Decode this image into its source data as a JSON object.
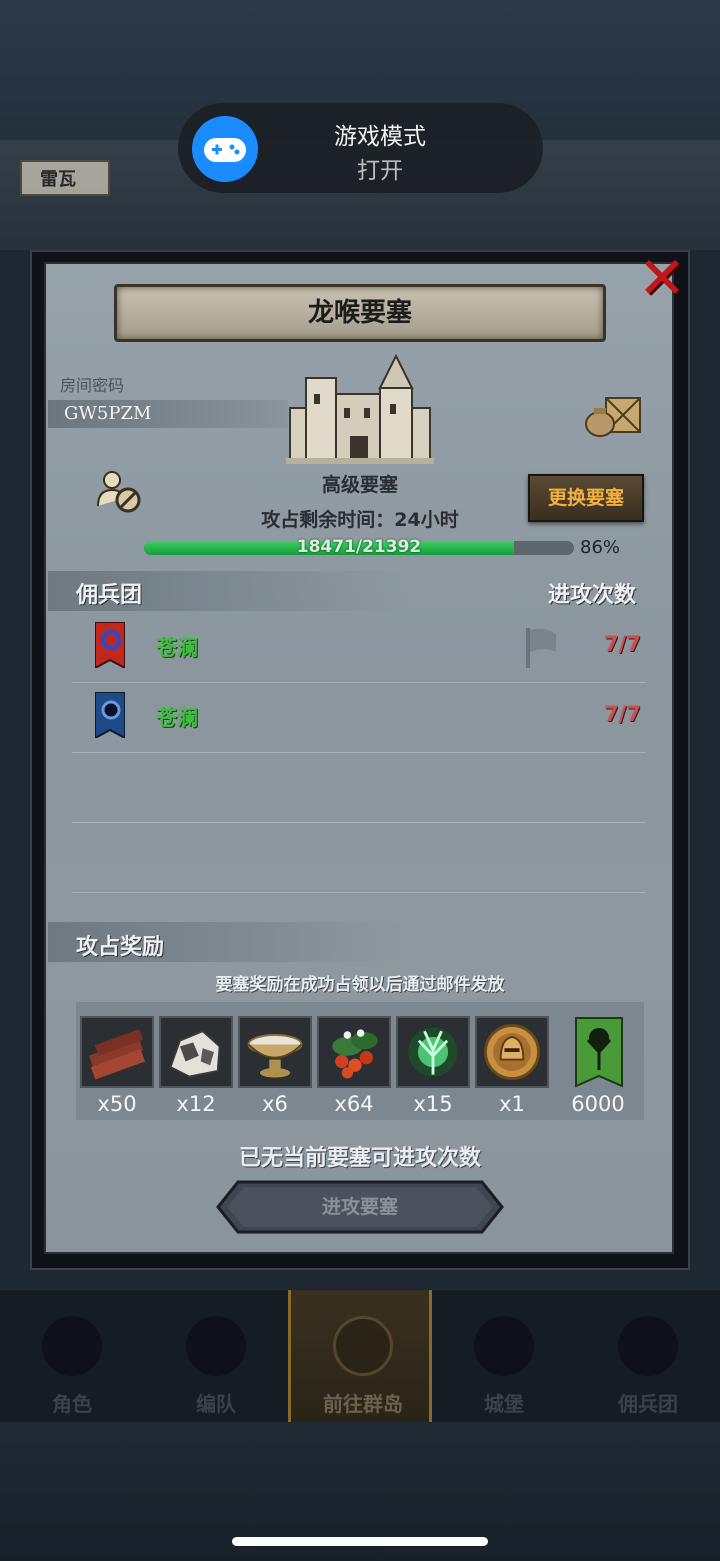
{
  "toast": {
    "title": "游戏模式",
    "subtitle": "打开"
  },
  "background": {
    "map_label": "雷瓦"
  },
  "panel": {
    "title": "龙喉要塞",
    "room_label": "房间密码",
    "room_code": "GW5PZM",
    "fort_level": "高级要塞",
    "change_button": "更换要塞",
    "remaining_time": "攻占剩余时间：24小时",
    "progress": {
      "current": 18471,
      "total": 21392,
      "text": "18471/21392",
      "percent_text": "86%",
      "percent": 86
    }
  },
  "mercenaries": {
    "header": "佣兵团",
    "attack_header": "进攻次数",
    "rows": [
      {
        "name": "苍澜",
        "attempts": "7/7",
        "banner_color": "#c0281e"
      },
      {
        "name": "苍澜",
        "attempts": "7/7",
        "banner_color": "#1e4a88"
      }
    ]
  },
  "rewards": {
    "header": "攻占奖励",
    "note": "要塞奖励在成功占领以后通过邮件发放",
    "items": [
      {
        "icon": "wood-icon",
        "qty": "x50"
      },
      {
        "icon": "ore-icon",
        "qty": "x12"
      },
      {
        "icon": "bowl-icon",
        "qty": "x6"
      },
      {
        "icon": "berries-icon",
        "qty": "x64"
      },
      {
        "icon": "tree-spirit-icon",
        "qty": "x15"
      },
      {
        "icon": "helmet-coin-icon",
        "qty": "x1"
      },
      {
        "icon": "guild-banner-icon",
        "qty": "6000"
      }
    ]
  },
  "no_attempts_text": "已无当前要塞可进攻次数",
  "attack_button": "进攻要塞",
  "nav": [
    {
      "label": "角色",
      "icon": "knight-icon"
    },
    {
      "label": "编队",
      "icon": "helmet-icon"
    },
    {
      "label": "前往群岛",
      "icon": "compass-icon",
      "active": true
    },
    {
      "label": "城堡",
      "icon": "castle-icon"
    },
    {
      "label": "佣兵团",
      "icon": "warrior-icon"
    }
  ],
  "colors": {
    "accent_green": "#40c040",
    "attempt_red": "#c85050",
    "button_gold": "#f2b040",
    "toast_blue": "#1a8cff"
  }
}
